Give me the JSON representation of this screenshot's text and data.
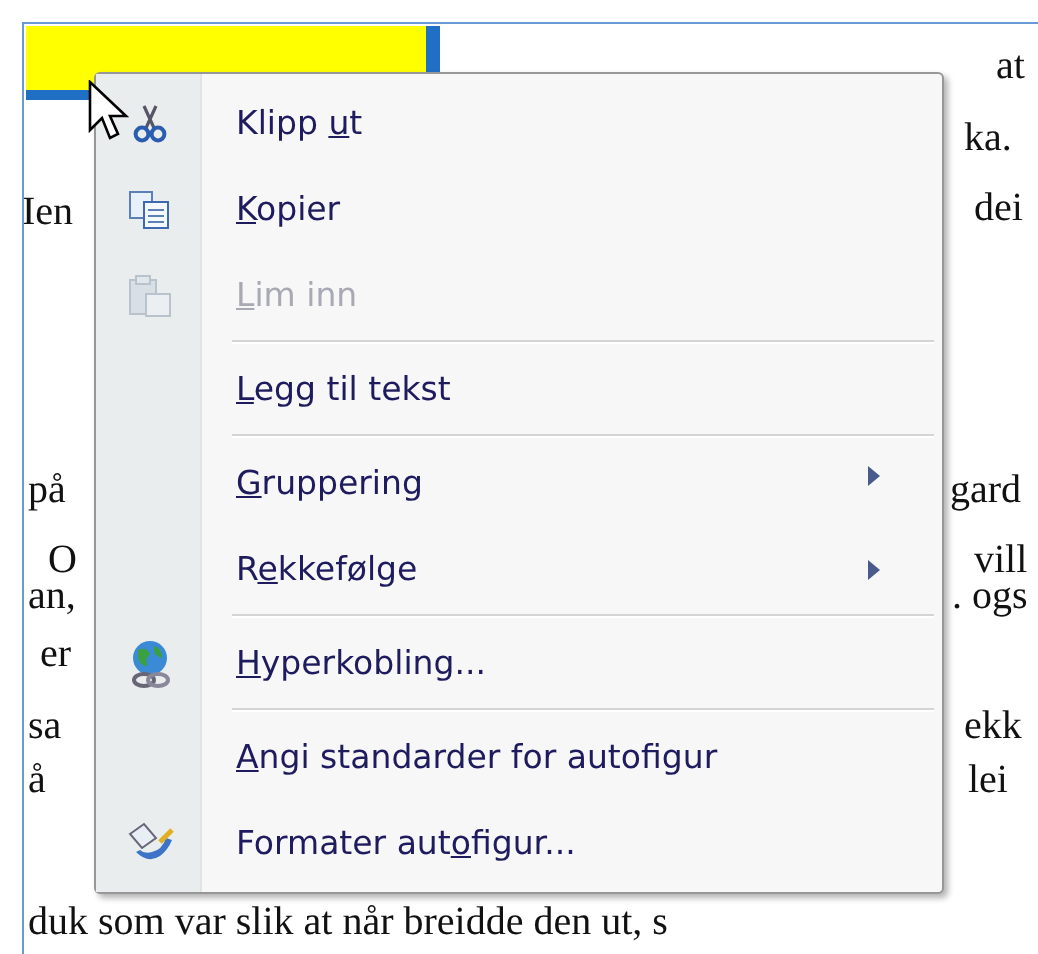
{
  "document": {
    "right_fragments": [
      "at",
      "ka.",
      "dei",
      "gard",
      "vill",
      ". ogs",
      "ekk",
      "lei"
    ],
    "left_fragments": [
      "Ien",
      "på",
      "O",
      "an,",
      "er",
      "sa",
      "å"
    ],
    "bottom_line": "duk som var slik  at når breidde den ut, s"
  },
  "context_menu": {
    "items": [
      {
        "prefix": "Klipp ",
        "key": "u",
        "rest": "t",
        "disabled": false,
        "submenu": false,
        "separator_before": false
      },
      {
        "key": "K",
        "rest": "opier",
        "disabled": false,
        "submenu": false,
        "separator_before": false
      },
      {
        "key": "L",
        "rest": "im inn",
        "disabled": true,
        "submenu": false,
        "separator_before": false
      },
      {
        "key": "L",
        "rest": "egg til tekst",
        "disabled": false,
        "submenu": false,
        "separator_before": true
      },
      {
        "key": "G",
        "rest": "ruppering",
        "disabled": false,
        "submenu": true,
        "separator_before": true
      },
      {
        "prefix": "R",
        "key": "e",
        "rest": "kkefølge",
        "disabled": false,
        "submenu": true,
        "separator_before": false
      },
      {
        "key": "H",
        "rest": "yperkobling...",
        "disabled": false,
        "submenu": false,
        "separator_before": true
      },
      {
        "key": "A",
        "rest": "ngi standarder for autofigur",
        "disabled": false,
        "submenu": false,
        "separator_before": true
      },
      {
        "prefix": "Formater aut",
        "key": "o",
        "rest": "figur...",
        "disabled": false,
        "submenu": false,
        "separator_before": false
      }
    ]
  }
}
